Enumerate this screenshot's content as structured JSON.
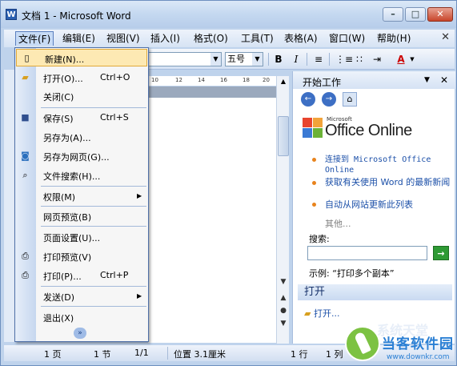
{
  "window": {
    "title": "文档 1 - Microsoft Word",
    "app_icon": "W",
    "controls": {
      "minimize": "–",
      "maximize": "□",
      "close": "✕"
    }
  },
  "menubar": {
    "items": [
      "文件(F)",
      "编辑(E)",
      "视图(V)",
      "插入(I)",
      "格式(O)",
      "工具(T)",
      "表格(A)",
      "窗口(W)",
      "帮助(H)"
    ],
    "close_doc": "✕"
  },
  "toolbar": {
    "font_size": "五号",
    "bold": "B",
    "italic": "I",
    "font_color": "A"
  },
  "ruler": {
    "ticks": [
      "10",
      "12",
      "14",
      "16",
      "18",
      "20",
      "22",
      "24",
      "26",
      "28",
      "30"
    ]
  },
  "file_menu": {
    "items": [
      {
        "label": "新建(N)...",
        "shortcut": "",
        "icon": "new-document-icon"
      },
      {
        "label": "打开(O)...",
        "shortcut": "Ctrl+O",
        "icon": "open-folder-icon"
      },
      {
        "label": "关闭(C)",
        "shortcut": "",
        "icon": ""
      },
      {
        "label": "保存(S)",
        "shortcut": "Ctrl+S",
        "icon": "save-disk-icon"
      },
      {
        "label": "另存为(A)...",
        "shortcut": "",
        "icon": ""
      },
      {
        "label": "另存为网页(G)...",
        "shortcut": "",
        "icon": "web-page-icon"
      },
      {
        "label": "文件搜索(H)...",
        "shortcut": "",
        "icon": "file-search-icon"
      },
      {
        "label": "权限(M)",
        "shortcut": "",
        "icon": ""
      },
      {
        "label": "网页预览(B)",
        "shortcut": "",
        "icon": ""
      },
      {
        "label": "页面设置(U)...",
        "shortcut": "",
        "icon": ""
      },
      {
        "label": "打印预览(V)",
        "shortcut": "",
        "icon": "print-preview-icon"
      },
      {
        "label": "打印(P)...",
        "shortcut": "Ctrl+P",
        "icon": "printer-icon"
      },
      {
        "label": "发送(D)",
        "shortcut": "",
        "icon": ""
      },
      {
        "label": "退出(X)",
        "shortcut": "",
        "icon": ""
      }
    ],
    "expand": "»"
  },
  "taskpane": {
    "title": "开始工作",
    "logo_small": "Microsoft",
    "logo": "Office Online",
    "links": [
      "连接到 Microsoft Office Online",
      "获取有关使用 Word 的最新新闻",
      "自动从网站更新此列表"
    ],
    "more": "其他...",
    "search_label": "搜索:",
    "search_value": "",
    "go": "→",
    "example": "示例: “打印多个副本”",
    "open_section": "打开",
    "open_link": "打开..."
  },
  "statusbar": {
    "page": "1 页",
    "section": "1 节",
    "pages": "1/1",
    "position": "位置 3.1厘米",
    "line": "1 行",
    "col": "1 列"
  },
  "watermark": {
    "top": "系统天堂",
    "brand": "当客软件园",
    "url": "www.downkr.com"
  },
  "colors": {
    "frame": "#bfd3ec",
    "menu_hover": "#fde9b3",
    "link": "#1b4fa8",
    "bullet": "#e8831c"
  }
}
